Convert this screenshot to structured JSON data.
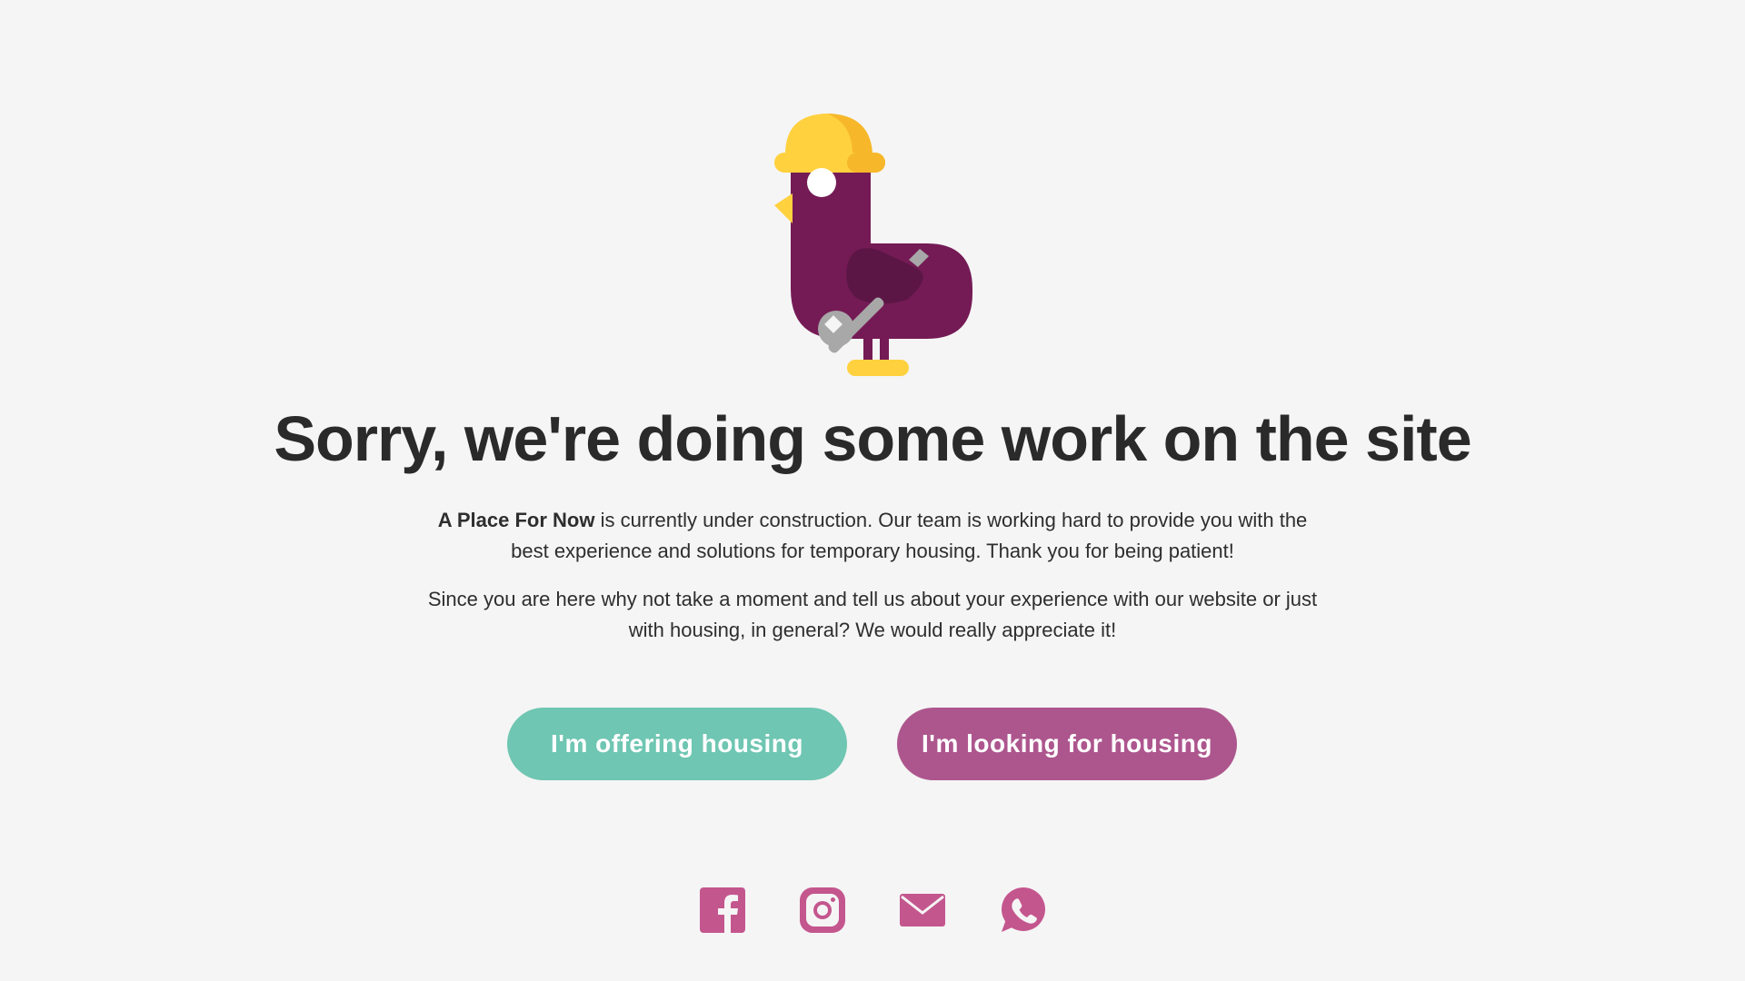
{
  "colors": {
    "background": "#f5f5f5",
    "offer_button": "#6fc6b2",
    "look_button": "#ad568e",
    "social_icon": "#c4568e",
    "bird_body": "#741b55",
    "helmet": "#ffd13e"
  },
  "headline": "Sorry, we're doing some work on the site",
  "intro": {
    "brand": "A Place For Now",
    "text": " is currently under construction. Our team is working hard to provide you with the best experience and solutions for temporary housing. Thank you for being patient!"
  },
  "feedback_text": "Since you are here why not take a moment and tell us about your experience with our website or just with housing, in general? We would really appreciate it!",
  "buttons": {
    "offering": "I'm offering housing",
    "looking": "I'm looking for housing"
  },
  "socials": [
    {
      "icon": "facebook-icon"
    },
    {
      "icon": "instagram-icon"
    },
    {
      "icon": "mail-icon"
    },
    {
      "icon": "whatsapp-icon"
    }
  ]
}
